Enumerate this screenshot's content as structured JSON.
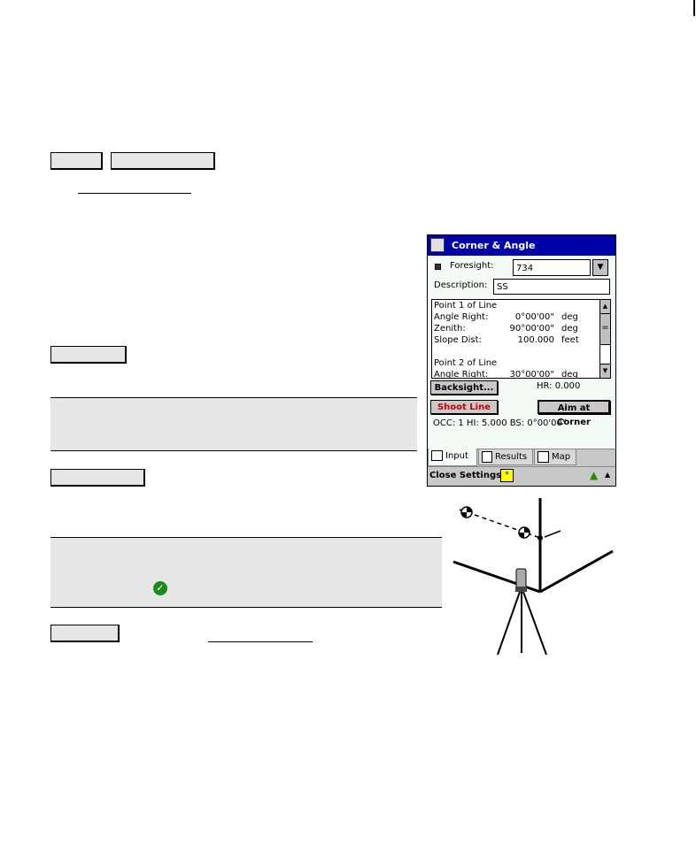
{
  "device_screen": {
    "title": "Corner & Angle",
    "foresight_label": "Foresight:",
    "foresight_value": "734",
    "description_label": "Description:",
    "description_value": "SS",
    "list": [
      {
        "label": "Point 1 of Line",
        "value": "",
        "unit": ""
      },
      {
        "label": "Angle Right:",
        "value": "0°00'00\"",
        "unit": "deg"
      },
      {
        "label": "Zenith:",
        "value": "90°00'00\"",
        "unit": "deg"
      },
      {
        "label": "Slope Dist:",
        "value": "100.000",
        "unit": "feet"
      },
      {
        "label": "",
        "value": "",
        "unit": ""
      },
      {
        "label": "Point 2 of Line",
        "value": "",
        "unit": ""
      },
      {
        "label": "Angle Right:",
        "value": "30°00'00\"",
        "unit": "deg"
      }
    ],
    "backsight_button": "Backsight...",
    "hr_text": "HR: 0.000",
    "shoot_line_button": "Shoot Line",
    "aim_at_corner_button": "Aim at Corner",
    "status_text": "OCC: 1  HI: 5.000  BS: 0°00'00\"",
    "tabs": [
      "Input",
      "Results",
      "Map"
    ],
    "close_settings": "Close Settings",
    "shoot_color": "#cc0000",
    "title_bar_color": "#0000a8"
  }
}
